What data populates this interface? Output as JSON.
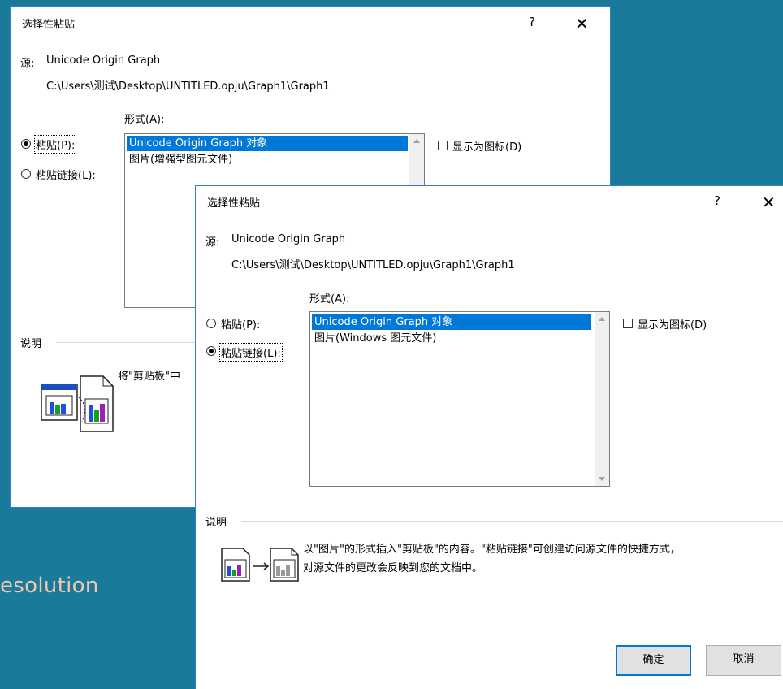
{
  "background": {
    "partial_text": "esolution",
    "color": "#1a7a9a"
  },
  "dialog_back": {
    "title": "选择性粘贴",
    "help": "?",
    "close": "✕",
    "source_label": "源:",
    "source_name": "Unicode Origin Graph",
    "source_path": "C:\\Users\\测试\\Desktop\\UNTITLED.opju\\Graph1\\Graph1",
    "format_label": "形式(A):",
    "radio_paste": "粘贴(P):",
    "radio_paste_link": "粘贴链接(L):",
    "list_items": [
      "Unicode Origin Graph 对象",
      "图片(增强型图元文件)"
    ],
    "display_as_icon": "显示为图标(D)",
    "description_label": "说明",
    "description_text": "将\"剪贴板\"中"
  },
  "dialog_front": {
    "title": "选择性粘贴",
    "help": "?",
    "close": "✕",
    "source_label": "源:",
    "source_name": "Unicode Origin Graph",
    "source_path": "C:\\Users\\测试\\Desktop\\UNTITLED.opju\\Graph1\\Graph1",
    "format_label": "形式(A):",
    "radio_paste": "粘贴(P):",
    "radio_paste_link": "粘贴链接(L):",
    "list_items": [
      "Unicode Origin Graph 对象",
      "图片(Windows 图元文件)"
    ],
    "display_as_icon": "显示为图标(D)",
    "description_label": "说明",
    "description_line1": "以\"图片\"的形式插入\"剪贴板\"的内容。\"粘贴链接\"可创建访问源文件的快捷方式，",
    "description_line2": "对源文件的更改会反映到您的文档中。",
    "ok_button": "确定",
    "cancel_button": "取消"
  },
  "colors": {
    "selection": "#0078d7",
    "border": "#2b7fd6"
  }
}
